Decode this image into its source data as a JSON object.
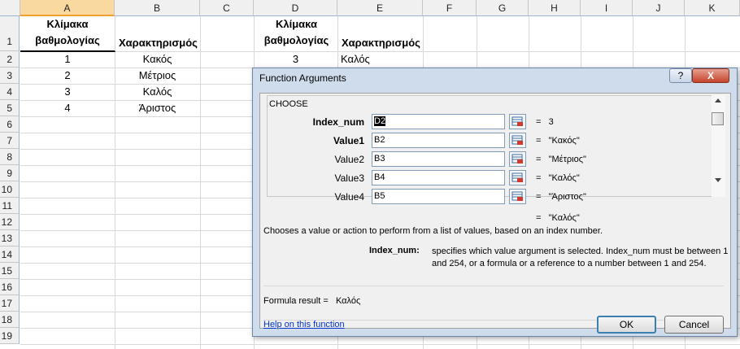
{
  "spreadsheet": {
    "columns": [
      "A",
      "B",
      "C",
      "D",
      "E",
      "F",
      "G",
      "H",
      "I",
      "J",
      "K"
    ],
    "rows": [
      "1",
      "2",
      "3",
      "4",
      "5",
      "6",
      "7",
      "8",
      "9",
      "10",
      "11",
      "12",
      "13",
      "14",
      "15",
      "16",
      "17",
      "18",
      "19"
    ],
    "a1_line1": "Κλίμακα",
    "a1_line2": "βαθμολογίας",
    "b1": "Χαρακτηρισμός",
    "d1_line1": "Κλίμακα",
    "d1_line2": "βαθμολογίας",
    "e1": "Χαρακτηρισμός",
    "a_values": [
      "1",
      "2",
      "3",
      "4"
    ],
    "b_values": [
      "Κακός",
      "Μέτριος",
      "Καλός",
      "Άριστος"
    ],
    "d2": "3",
    "e2": "Καλός"
  },
  "dialog": {
    "title": "Function Arguments",
    "help_button": "?",
    "close_button": "X",
    "function_name": "CHOOSE",
    "args": [
      {
        "label": "Index_num",
        "input": "D2",
        "value": "3"
      },
      {
        "label": "Value1",
        "input": "B2",
        "value": "\"Κακός\""
      },
      {
        "label": "Value2",
        "input": "B3",
        "value": "\"Μέτριος\""
      },
      {
        "label": "Value3",
        "input": "B4",
        "value": "\"Καλός\""
      },
      {
        "label": "Value4",
        "input": "B5",
        "value": "\"Άριστος\""
      }
    ],
    "equals": "=",
    "overall_result": "\"Καλός\"",
    "description": "Chooses a value or action to perform from a list of values, based on an index number.",
    "arg_help_label": "Index_num:",
    "arg_help_line1": "specifies which value argument is selected. Index_num must be between 1",
    "arg_help_line2": "and 254, or a formula or a reference to a number between 1 and 254.",
    "formula_result_label": "Formula result =",
    "formula_result_value": "Καλός",
    "help_link": "Help on this function",
    "ok_label": "OK",
    "cancel_label": "Cancel"
  }
}
